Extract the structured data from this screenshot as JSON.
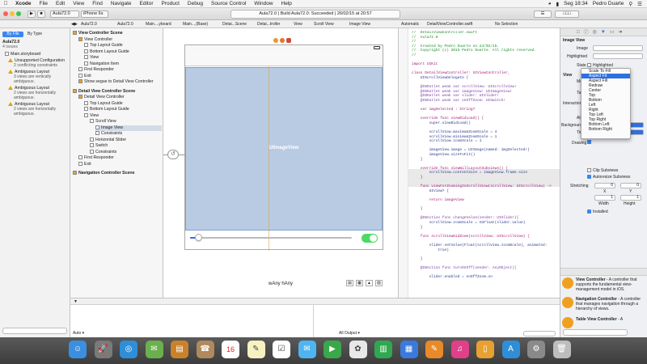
{
  "menubar": {
    "apple": "",
    "items": [
      "Xcode",
      "File",
      "Edit",
      "View",
      "Find",
      "Navigate",
      "Editor",
      "Product",
      "Debug",
      "Source Control",
      "Window",
      "Help"
    ],
    "clock": "Seg 18:34",
    "user": "Pedro Duarte"
  },
  "toolbar": {
    "scheme": "Aula72.0",
    "device": "iPhone 6s",
    "activity_project": "Aula72.0",
    "activity_status": "Build Aula72.0: Succeeded",
    "activity_time": "26/02/15 at 20:57"
  },
  "jumpbar": {
    "left": [
      "Aula72.0",
      "Aula72.0",
      "Main....yboard",
      "Main....(Base)",
      "Detai...Scene",
      "Detai...troller",
      "View",
      "Scroll View",
      "Image View"
    ],
    "right": [
      "Automatic",
      "DetailViewController.swift",
      "No Selection"
    ]
  },
  "navigator": {
    "tabs": [
      "By File",
      "By Type"
    ],
    "project": "Aula72.0",
    "issues_count": "4 issues",
    "items": [
      {
        "label": "Main.storyboard",
        "sub": ""
      },
      {
        "label": "Unsupported Configuration",
        "sub": "2 conflicting constraints"
      },
      {
        "label": "Ambiguous Layout",
        "sub": "3 views are vertically ambiguous."
      },
      {
        "label": "Ambiguous Layout",
        "sub": "2 views are horizontally ambiguous."
      },
      {
        "label": "Ambiguous Layout",
        "sub": "2 views are horizontally ambiguous."
      }
    ],
    "filter_placeholder": ""
  },
  "outline": {
    "scenes": [
      {
        "label": "View Controller Scene",
        "level": 0
      },
      {
        "label": "View Controller",
        "level": 1
      },
      {
        "label": "Top Layout Guide",
        "level": 2
      },
      {
        "label": "Bottom Layout Guide",
        "level": 2
      },
      {
        "label": "View",
        "level": 2
      },
      {
        "label": "Navigation Item",
        "level": 2
      },
      {
        "label": "First Responder",
        "level": 1
      },
      {
        "label": "Exit",
        "level": 1
      },
      {
        "label": "Show segue to Detail View Controller",
        "level": 1
      },
      {
        "label": "Detail View Controller Scene",
        "level": 0
      },
      {
        "label": "Detail View Controller",
        "level": 1
      },
      {
        "label": "Top Layout Guide",
        "level": 2
      },
      {
        "label": "Bottom Layout Guide",
        "level": 2
      },
      {
        "label": "View",
        "level": 2
      },
      {
        "label": "Scroll View",
        "level": 3
      },
      {
        "label": "Image View",
        "level": 4
      },
      {
        "label": "Constraints",
        "level": 4
      },
      {
        "label": "Horizontal Slider",
        "level": 3
      },
      {
        "label": "Switch",
        "level": 3
      },
      {
        "label": "Constraints",
        "level": 3
      },
      {
        "label": "First Responder",
        "level": 1
      },
      {
        "label": "Exit",
        "level": 1
      },
      {
        "label": "Navigation Controller Scene",
        "level": 0
      }
    ]
  },
  "canvas": {
    "imageview_label": "UIImageView",
    "size_class": "wAny hAny",
    "switch_on": true,
    "slider_value": 0.05
  },
  "code_lines": [
    "//  DetailViewController.swift",
    "//  Aula72.0",
    "//",
    "//  Created by Pedro Duarte on 24/02/15.",
    "//  Copyright (c) 2015 Pedro Duarte. All rights reserved.",
    "//",
    "",
    "import UIKit",
    "",
    "class DetailViewController: UIViewController,",
    "    UIScrollViewDelegate {",
    "",
    "    @IBOutlet weak var scrollView: UIScrollView!",
    "    @IBOutlet weak var imageView: UIImageView!",
    "    @IBOutlet weak var slider: UISlider!",
    "    @IBOutlet weak var onOffZoom: UISwitch!",
    "",
    "    var imgSelected : String?",
    "",
    "    override func viewDidLoad() {",
    "        super.viewDidLoad()",
    "",
    "        scrollView.maximumZoomScale = 4",
    "        scrollView.minimumZoomScale = 1",
    "        scrollView.zoomScale = 1",
    "",
    "        imageView.image = UIImage(named: imgSelected!)",
    "        imageView.sizeToFit()",
    "    }",
    "",
    "    override func viewWillLayoutSubviews() {",
    "        scrollView.contentSize = imageView.frame.size",
    "    }",
    "",
    "    func viewForZoomingInScrollView(scrollView: UIScrollView) ->",
    "        UIView? {",
    "",
    "        return imageView",
    "",
    "    }",
    "",
    "    @IBAction func changeValue(sender: UISlider){",
    "        scrollView.zoomScale = CGFloat(slider.value)",
    "    }",
    "",
    "    func scrollViewDidZoom(scrollView: UIScrollView) {",
    "",
    "        slider.setValue(Float(scrollView.zoomScale), animated:",
    "            true)",
    "",
    "    }",
    "",
    "    @IBAction func turnOnOff(sender: AnyObject){",
    "",
    "        slider.enabled = onOffZoom.on"
  ],
  "inspector": {
    "section_imageview": "Image View",
    "image_label": "Image",
    "highlighted_label": "Highlighted",
    "state_label": "State",
    "state_value": "Highlighted",
    "view_section": "View",
    "mode_label": "Mode",
    "tag_label": "Tag",
    "interaction_label": "Interaction",
    "alpha_label": "Alpha",
    "background_label": "Background",
    "tint_label": "Tint",
    "drawing_label": "Drawing",
    "checks": [
      "Clip Subviews",
      "Autoresize Subviews"
    ],
    "stretching_label": "Stretching",
    "stretch_values": [
      "0",
      "0",
      "1",
      "1"
    ],
    "stretch_axes": [
      "X",
      "Y",
      "Width",
      "Height"
    ],
    "installed_label": "Installed",
    "mode_options": [
      "Scale To Fill",
      "Aspect Fit",
      "Aspect Fill",
      "Redraw",
      "Center",
      "Top",
      "Bottom",
      "Left",
      "Right",
      "Top Left",
      "Top Right",
      "Bottom Left",
      "Bottom Right"
    ],
    "mode_selected": "Aspect Fit",
    "library": [
      {
        "title": "View Controller",
        "desc": "- A controller that supports the fundamental view-management model in iOS."
      },
      {
        "title": "Navigation Controller",
        "desc": "- A controller that manages navigation through a hierarchy of views."
      },
      {
        "title": "Table View Controller",
        "desc": "- A"
      }
    ]
  },
  "debug": {
    "left_filter": "Auto",
    "right_filter": "All Output"
  },
  "colors": {
    "imageview_bg": "#b8cbe3",
    "selection": "#2f6fe0",
    "switch_on": "#4cd964",
    "warning": "#e2a400"
  },
  "dock": [
    "finder-icon",
    "launchpad-icon",
    "safari-icon",
    "photos-preview-icon",
    "books-icon",
    "contacts-icon",
    "calendar-icon",
    "notes-icon",
    "reminders-icon",
    "messages-icon",
    "facetime-icon",
    "photos-icon",
    "numbers-icon",
    "keynote-icon",
    "pages-icon",
    "itunes-icon",
    "ibooks-icon",
    "app-store-icon",
    "system-preferences-icon",
    "trash-icon"
  ],
  "dock_labels": {
    "calendar_day": "16",
    "calendar_month": "FEB"
  }
}
